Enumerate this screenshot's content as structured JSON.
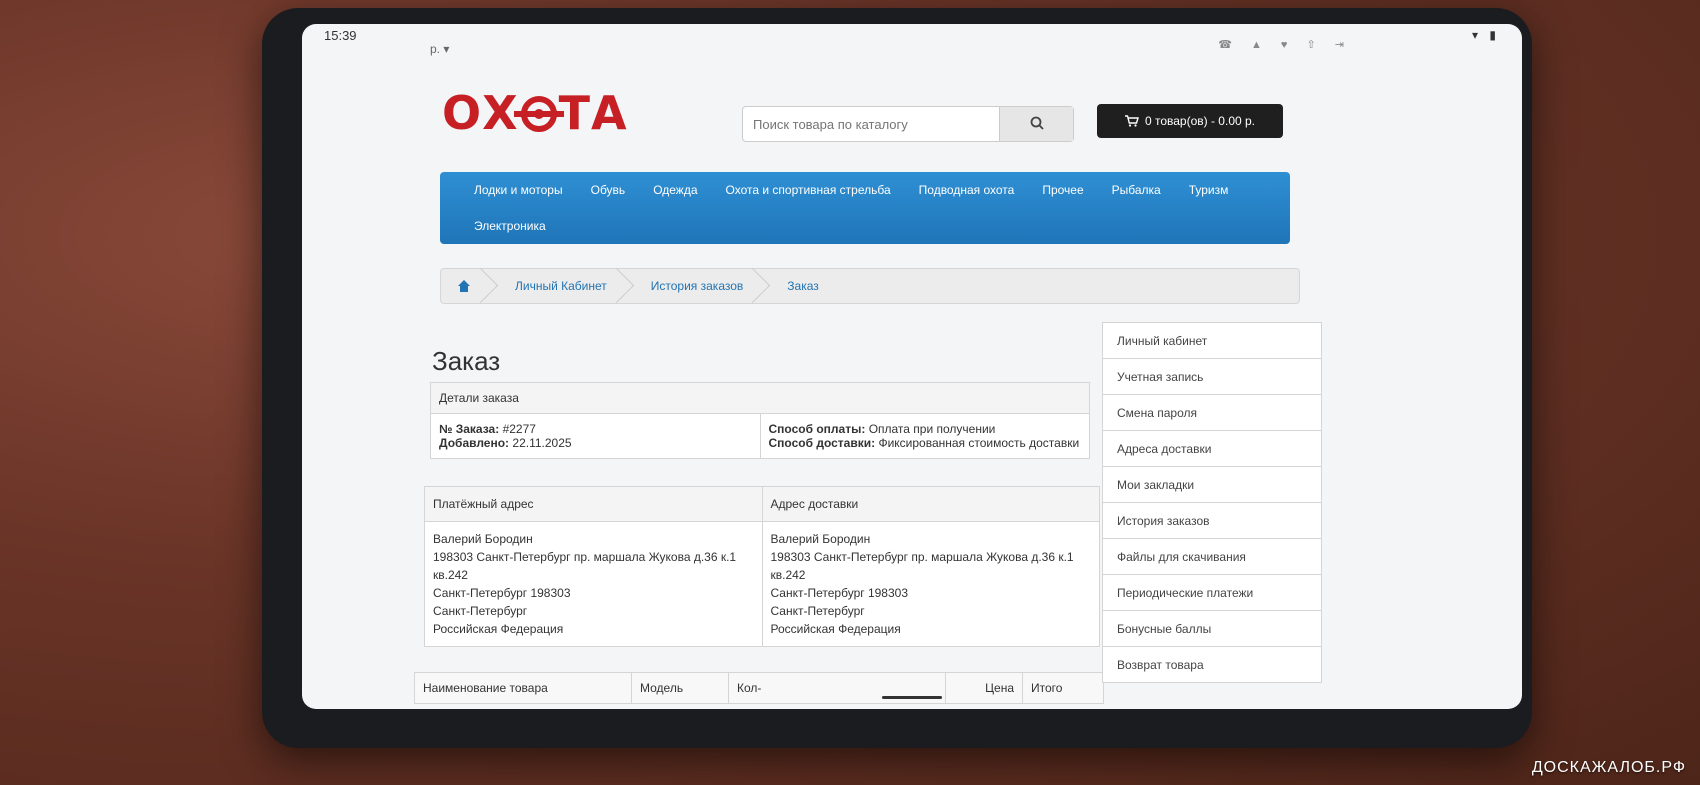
{
  "status": {
    "time": "15:39"
  },
  "topbar": {
    "currency": "р. ▾"
  },
  "logo": {
    "text_left": "ОХ",
    "text_right": "ТА"
  },
  "search": {
    "placeholder": "Поиск товара по каталогу",
    "icon": "search-icon"
  },
  "cart": {
    "label": "0 товар(ов) - 0.00 р.",
    "icon": "cart-icon"
  },
  "menu": {
    "row1": [
      "Лодки и моторы",
      "Обувь",
      "Одежда",
      "Охота и спортивная стрельба",
      "Подводная охота",
      "Прочее",
      "Рыбалка",
      "Туризм"
    ],
    "row2": [
      "Электроника"
    ]
  },
  "breadcrumb": {
    "home_icon": "home-icon",
    "items": [
      "Личный Кабинет",
      "История заказов",
      "Заказ"
    ]
  },
  "page_title": "Заказ",
  "order_details": {
    "header": "Детали заказа",
    "order_no_label": "№ Заказа:",
    "order_no": "#2277",
    "added_label": "Добавлено:",
    "added": "22.11.2025",
    "payment_label": "Способ оплаты:",
    "payment": "Оплата при получении",
    "shipping_label": "Способ доставки:",
    "shipping": "Фиксированная стоимость доставки"
  },
  "addresses": {
    "payment_header": "Платёжный адрес",
    "shipping_header": "Адрес доставки",
    "payment_lines": [
      "Валерий Бородин",
      "198303 Санкт-Петербург пр. маршала Жукова д.36 к.1",
      "кв.242",
      "Санкт-Петербург 198303",
      "Санкт-Петербург",
      "Российская Федерация"
    ],
    "shipping_lines": [
      "Валерий Бородин",
      "198303 Санкт-Петербург пр. маршала Жукова д.36 к.1",
      "кв.242",
      "Санкт-Петербург 198303",
      "Санкт-Петербург",
      "Российская Федерация"
    ]
  },
  "products": {
    "columns": [
      "Наименование товара",
      "Модель",
      "Кол-",
      "Цена",
      "Итого"
    ]
  },
  "sidebar": {
    "items": [
      "Личный кабинет",
      "Учетная запись",
      "Смена пароля",
      "Адреса доставки",
      "Мои закладки",
      "История заказов",
      "Файлы для скачивания",
      "Периодические платежи",
      "Бонусные баллы",
      "Возврат товара"
    ]
  },
  "watermark": "ДОСКАЖАЛОБ.РФ"
}
